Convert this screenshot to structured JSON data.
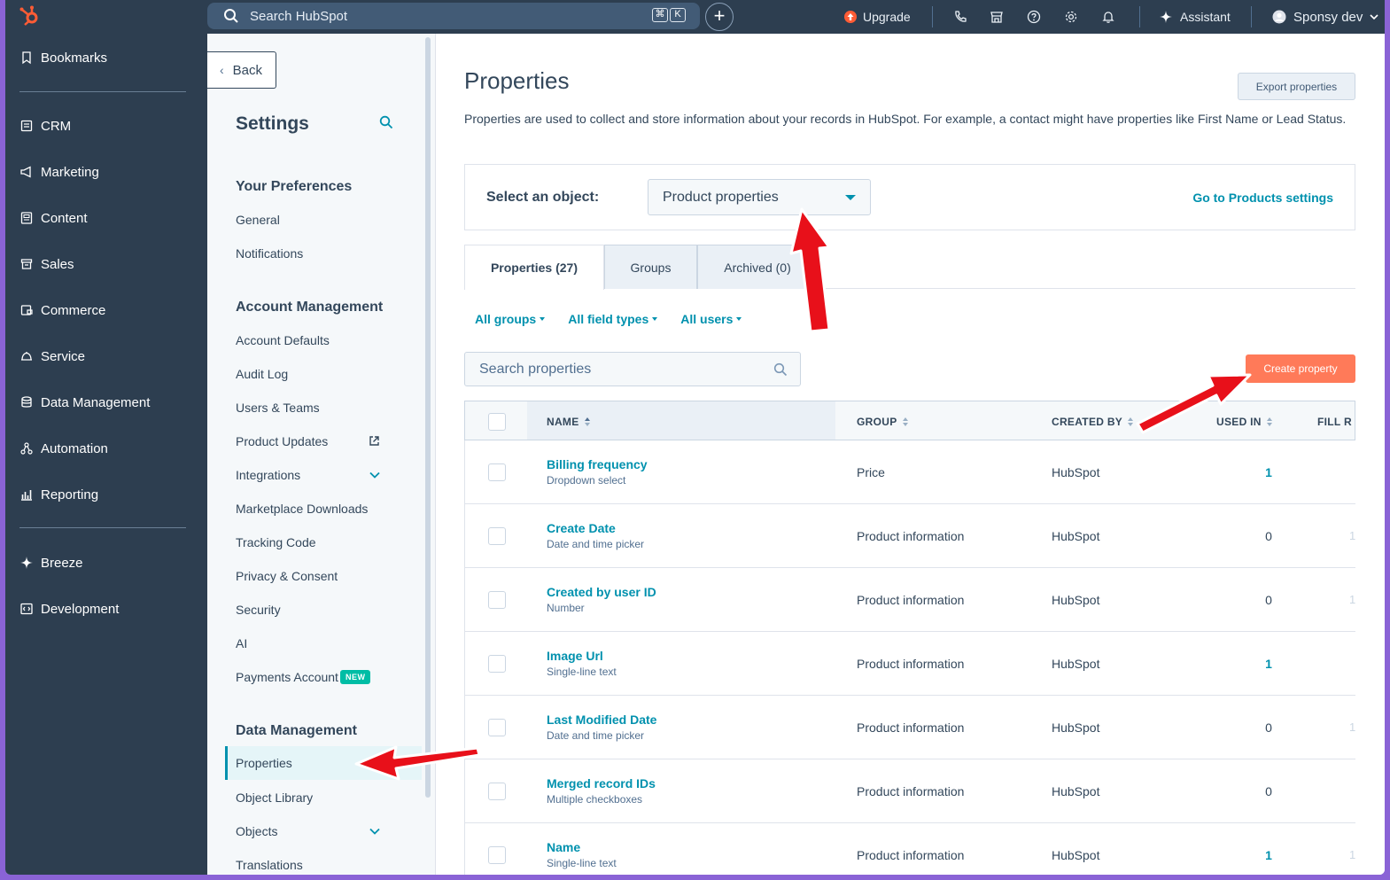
{
  "topbar": {
    "search_placeholder": "Search HubSpot",
    "kbd_cmd": "⌘",
    "kbd_k": "K",
    "plus": "+",
    "upgrade": "Upgrade",
    "assistant": "Assistant",
    "account": "Sponsy dev"
  },
  "leftnav": {
    "items": [
      {
        "label": "Bookmarks",
        "icon": "bookmark-icon"
      },
      {
        "label": "CRM",
        "icon": "crm-icon"
      },
      {
        "label": "Marketing",
        "icon": "megaphone-icon"
      },
      {
        "label": "Content",
        "icon": "content-icon"
      },
      {
        "label": "Sales",
        "icon": "sales-icon"
      },
      {
        "label": "Commerce",
        "icon": "commerce-icon"
      },
      {
        "label": "Service",
        "icon": "service-icon"
      },
      {
        "label": "Data Management",
        "icon": "database-icon"
      },
      {
        "label": "Automation",
        "icon": "automation-icon"
      },
      {
        "label": "Reporting",
        "icon": "reporting-icon"
      },
      {
        "label": "Breeze",
        "icon": "sparkle-icon"
      },
      {
        "label": "Development",
        "icon": "code-icon"
      }
    ]
  },
  "settings": {
    "back": "Back",
    "title": "Settings",
    "sections": {
      "preferences": "Your Preferences",
      "account": "Account Management",
      "data": "Data Management"
    },
    "preferences_items": [
      "General",
      "Notifications"
    ],
    "account_items": [
      "Account Defaults",
      "Audit Log",
      "Users & Teams",
      "Product Updates",
      "Integrations",
      "Marketplace Downloads",
      "Tracking Code",
      "Privacy & Consent",
      "Security",
      "AI",
      "Payments Account"
    ],
    "new_badge": "NEW",
    "data_items": [
      "Properties",
      "Object Library",
      "Objects",
      "Translations"
    ]
  },
  "main": {
    "title": "Properties",
    "export": "Export properties",
    "description": "Properties are used to collect and store information about your records in HubSpot. For example, a contact might have properties like First Name or Lead Status.",
    "select_label": "Select an object:",
    "select_value": "Product properties",
    "goto_link": "Go to Products settings",
    "tabs": [
      "Properties (27)",
      "Groups",
      "Archived (0)"
    ],
    "filters": [
      "All groups",
      "All field types",
      "All users"
    ],
    "search_placeholder": "Search properties",
    "create": "Create property"
  },
  "table": {
    "headers": {
      "name": "NAME",
      "group": "GROUP",
      "created_by": "CREATED BY",
      "used_in": "USED IN",
      "fill_rate": "FILL R"
    },
    "rows": [
      {
        "name": "Billing frequency",
        "type": "Dropdown select",
        "group": "Price",
        "created_by": "HubSpot",
        "used_in": "1",
        "fill": ""
      },
      {
        "name": "Create Date",
        "type": "Date and time picker",
        "group": "Product information",
        "created_by": "HubSpot",
        "used_in": "0",
        "fill": "1"
      },
      {
        "name": "Created by user ID",
        "type": "Number",
        "group": "Product information",
        "created_by": "HubSpot",
        "used_in": "0",
        "fill": "1"
      },
      {
        "name": "Image Url",
        "type": "Single-line text",
        "group": "Product information",
        "created_by": "HubSpot",
        "used_in": "1",
        "fill": ""
      },
      {
        "name": "Last Modified Date",
        "type": "Date and time picker",
        "group": "Product information",
        "created_by": "HubSpot",
        "used_in": "0",
        "fill": "1"
      },
      {
        "name": "Merged record IDs",
        "type": "Multiple checkboxes",
        "group": "Product information",
        "created_by": "HubSpot",
        "used_in": "0",
        "fill": ""
      },
      {
        "name": "Name",
        "type": "Single-line text",
        "group": "Product information",
        "created_by": "HubSpot",
        "used_in": "1",
        "fill": "1"
      }
    ]
  },
  "colors": {
    "nav_bg": "#2d3e50",
    "accent": "#0091ae",
    "primary_button": "#ff7a59",
    "hubspot_orange": "#ff5c35",
    "annotation_arrow": "#e8101a",
    "outer_frame": "#8a63d6"
  }
}
